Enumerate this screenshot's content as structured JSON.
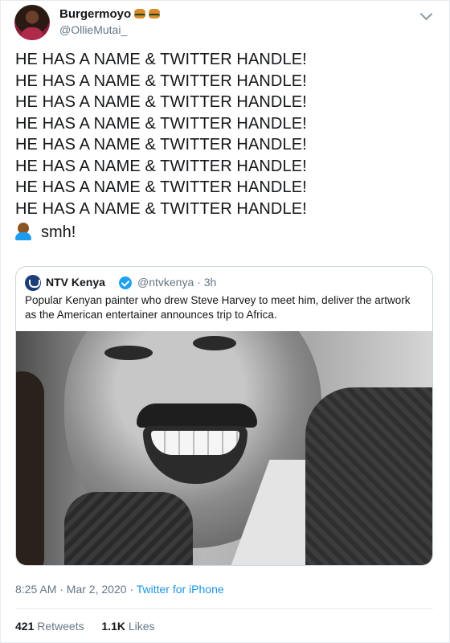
{
  "tweet": {
    "display_name": "Burgermoyo",
    "handle": "@OllieMutai_",
    "lines": [
      "HE HAS A NAME & TWITTER HANDLE!",
      "HE HAS A NAME & TWITTER HANDLE!",
      "HE HAS A NAME & TWITTER HANDLE!",
      "HE HAS A NAME & TWITTER HANDLE!",
      "HE HAS A NAME & TWITTER HANDLE!",
      "HE HAS A NAME & TWITTER HANDLE!",
      "HE HAS A NAME & TWITTER HANDLE!",
      "HE HAS A NAME & TWITTER HANDLE!"
    ],
    "last_line": "smh!",
    "emoji_icons": [
      "hamburger-icon",
      "hamburger-icon",
      "person-facepalming-icon"
    ]
  },
  "quoted": {
    "name": "NTV Kenya",
    "handle_time": "@ntvkenya · 3h",
    "text": "Popular Kenyan painter who drew Steve Harvey to meet him, deliver the artwork as the American entertainer announces trip to Africa.",
    "verified_color": "#1da1f2"
  },
  "meta": {
    "time": "8:25 AM · Mar 2, 2020 · ",
    "source": "Twitter for iPhone"
  },
  "stats": {
    "retweets_count": "421",
    "retweets_label": "Retweets",
    "likes_count": "1.1K",
    "likes_label": "Likes"
  },
  "colors": {
    "link": "#1b95e0",
    "secondary_text": "#657786"
  }
}
